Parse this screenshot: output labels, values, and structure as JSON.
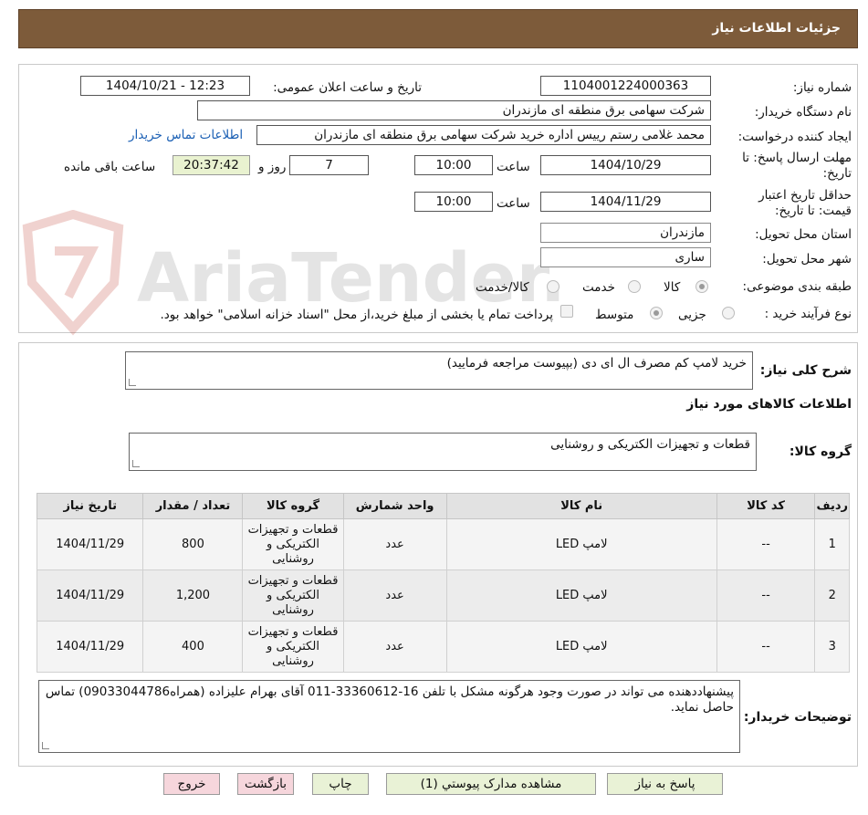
{
  "header": {
    "title": "جزئیات اطلاعات نیاز"
  },
  "watermark": {
    "text": "AriaTender.neT"
  },
  "form": {
    "need_number": {
      "label": "شماره نیاز:",
      "value": "1104001224000363"
    },
    "announce": {
      "label": "تاریخ و ساعت اعلان عمومی:",
      "value": "1404/10/21 - 12:23"
    },
    "buyer": {
      "label": "نام دستگاه خریدار:",
      "value": "شرکت سهامی برق منطقه ای مازندران"
    },
    "creator": {
      "label": "ایجاد کننده درخواست:",
      "value": "محمد غلامی رستم رییس اداره خرید شرکت سهامی برق منطقه ای مازندران",
      "contact_link": "اطلاعات تماس خریدار"
    },
    "reply_deadline": {
      "label": "مهلت ارسال پاسخ: تا تاریخ:",
      "date": "1404/10/29",
      "time_label": "ساعت",
      "time": "10:00",
      "days": "7",
      "days_label": "روز و",
      "remaining": "20:37:42",
      "remaining_label": "ساعت باقی مانده"
    },
    "price_validity": {
      "label": "حداقل تاریخ اعتبار قیمت: تا تاریخ:",
      "date": "1404/11/29",
      "time_label": "ساعت",
      "time": "10:00"
    },
    "province": {
      "label": "استان محل تحویل:",
      "value": "مازندران"
    },
    "city": {
      "label": "شهر محل تحویل:",
      "value": "ساری"
    },
    "category": {
      "label": "طبقه بندی موضوعی:",
      "options": [
        "کالا",
        "خدمت",
        "کالا/خدمت"
      ],
      "selected": "کالا"
    },
    "process": {
      "label": "نوع فرآیند خرید :",
      "options": [
        "جزیی",
        "متوسط"
      ],
      "selected": "متوسط",
      "payment_note": "پرداخت تمام یا بخشی از مبلغ خرید،از محل \"اسناد خزانه اسلامی\" خواهد بود."
    }
  },
  "summary": {
    "label": "شرح کلی نیاز:",
    "value": "خرید لامپ کم مصرف ال ای دی (بپیوست مراجعه فرمایید)"
  },
  "goods_section": {
    "title": "اطلاعات کالاهای مورد نیاز"
  },
  "goods_group": {
    "label": "گروه کالا:",
    "value": "قطعات و تجهیزات الکتریکی و روشنایی"
  },
  "table": {
    "headers": [
      "ردیف",
      "کد کالا",
      "نام کالا",
      "واحد شمارش",
      "گروه کالا",
      "تعداد / مقدار",
      "تاریخ نیاز"
    ],
    "rows": [
      {
        "row": "1",
        "code": "--",
        "name": "لامپ LED",
        "unit": "عدد",
        "group": "قطعات و تجهیزات الکتریکی و روشنایی",
        "qty": "800",
        "date": "1404/11/29"
      },
      {
        "row": "2",
        "code": "--",
        "name": "لامپ LED",
        "unit": "عدد",
        "group": "قطعات و تجهیزات الکتریکی و روشنایی",
        "qty": "1,200",
        "date": "1404/11/29"
      },
      {
        "row": "3",
        "code": "--",
        "name": "لامپ LED",
        "unit": "عدد",
        "group": "قطعات و تجهیزات الکتریکی و روشنایی",
        "qty": "400",
        "date": "1404/11/29"
      }
    ]
  },
  "buyer_notes": {
    "label": "توضیحات خریدار:",
    "value": "پیشنهاددهنده می تواند در صورت وجود هرگونه مشکل با تلفن 16-33360612-011 آقای بهرام علیزاده (همراه09033044786) تماس حاصل نماید."
  },
  "buttons": {
    "reply": "پاسخ به نیاز",
    "attachments": "مشاهده مدارک پیوستي (1)",
    "print": "چاپ",
    "back": "بازگشت",
    "exit": "خروج"
  }
}
